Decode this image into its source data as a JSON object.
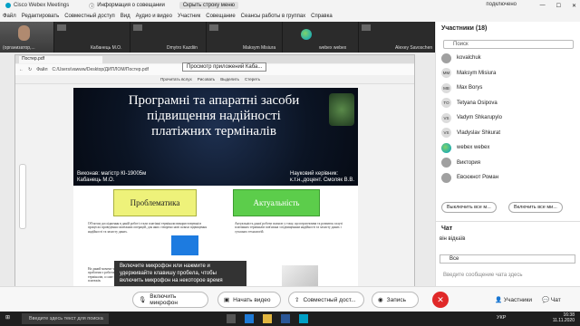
{
  "titlebar": {
    "app": "Cisco Webex Meetings",
    "info": "Информация о совещании",
    "hide": "Скрыть строку меню",
    "conn": "подключено"
  },
  "menu": [
    "Файл",
    "Редактировать",
    "Совместный доступ",
    "Вид",
    "Аудио и видео",
    "Участник",
    "Совещание",
    "Сеансы работы в группах",
    "Справка"
  ],
  "tiles": [
    "(организатор,...",
    "Кабанець М.О.",
    "Dmytro Kazdiin",
    "Maksym Misiura",
    "webex webex",
    "Alexey Savoschenko"
  ],
  "pdf": {
    "tab": "Постер.pdf",
    "tooltip": "Просмотр приложений Каба...",
    "file_label": "Файл",
    "path": "C:/Users/vawww/Desktop/ДИПЛОМ/Постер.pdf",
    "toolbar": [
      "Прочитать вслух",
      "Рисовать",
      "Выделить",
      "Стереть"
    ]
  },
  "poster": {
    "title": "Програмні та апаратні засоби підвищення надійності платіжних терміналів",
    "author_line1": "Виконав: магістр КІ-19005м",
    "author_line2": "Кабанець М.О.",
    "sup_line1": "Науковий керівник:",
    "sup_line2": "к.т.н.,доцент. Смоляк В.В.",
    "problem": "Проблематика",
    "relevance": "Актуальність",
    "text_left": "Об'єктом дослідження в даній роботі стали платіжні термінали використовувані в процесах проведення платіжних операцій, для яких створено нові шляхи підвищення надійності та захисту даних.",
    "text_right": "Актуальність даної роботи полягає у тому, що перспектива та розвиток галузі платіжних терміналів пов'язана з підвищенням надійності та захисту даних і сучасних технологій.",
    "text_left2": "На даний момент часто виникають проблеми з роботою платіжних терміналів, а саме збої при проведенні платежів."
  },
  "popup": "Включите микрофон или нажмите и удерживайте клавишу пробела, чтобы включить микрофон на некоторое время",
  "bottombar": {
    "mic": "Включить микрофон",
    "video": "Начать видео",
    "share": "Совместный дост...",
    "record": "Запись",
    "participants": "Участники",
    "chat": "Чат"
  },
  "participants": {
    "header": "Участники (18)",
    "search_placeholder": "Поиск",
    "list": [
      {
        "initials": "",
        "name": "kovalchuk"
      },
      {
        "initials": "MM",
        "name": "Maksym Misiura"
      },
      {
        "initials": "MB",
        "name": "Max Borys"
      },
      {
        "initials": "TO",
        "name": "Tetyana Osipova"
      },
      {
        "initials": "VS",
        "name": "Vadym Shkarupylo"
      },
      {
        "initials": "VS",
        "name": "Vladyslav Shkurat"
      },
      {
        "initials": "",
        "name": "webex webex"
      },
      {
        "initials": "",
        "name": "Виктория"
      },
      {
        "initials": "",
        "name": "Евсюкнот Роман"
      }
    ],
    "mute_all": "Выключить все м...",
    "unmute_all": "Включить все ми..."
  },
  "chat": {
    "header": "Чат",
    "message": "він відкаїв",
    "to": "Все",
    "placeholder": "Введите сообщение чата здесь"
  },
  "taskbar": {
    "search": "Введите здесь текст для поиска",
    "lang": "УКР",
    "time": "16:38",
    "date": "11.11.2020"
  },
  "colors": {
    "end_call": "#e02828",
    "problem_box": "#eef27a",
    "relevance_box": "#5ccd4b",
    "poster_bg": "#0b1424"
  }
}
